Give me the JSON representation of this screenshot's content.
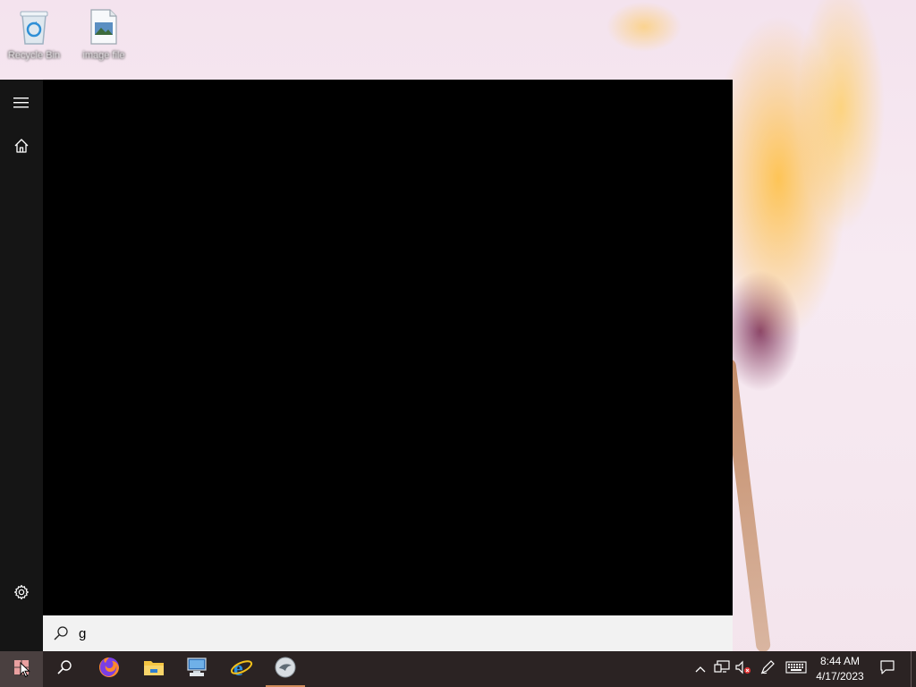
{
  "desktop": {
    "icons": [
      {
        "label": "Recycle Bin",
        "icon": "recycle-bin-icon"
      },
      {
        "label": "image file",
        "icon": "image-file-icon"
      }
    ]
  },
  "start_menu": {
    "rail": {
      "expand": {
        "icon": "hamburger-menu-icon"
      },
      "home": {
        "icon": "home-icon"
      },
      "settings": {
        "icon": "gear-icon"
      }
    },
    "search": {
      "value": "g",
      "icon": "search-icon"
    }
  },
  "taskbar": {
    "pinned": [
      {
        "name": "start",
        "icon": "windows-logo-icon"
      },
      {
        "name": "search",
        "icon": "search-icon"
      },
      {
        "name": "firefox",
        "icon": "firefox-icon"
      },
      {
        "name": "file-explorer",
        "icon": "folder-icon"
      },
      {
        "name": "network",
        "icon": "computer-network-icon"
      },
      {
        "name": "internet-explorer",
        "icon": "internet-explorer-icon"
      },
      {
        "name": "app",
        "icon": "app-icon",
        "active": true
      }
    ],
    "tray": {
      "icons": [
        "chevron-up-icon",
        "network-icon",
        "volume-muted-icon",
        "pen-icon",
        "keyboard-icon"
      ],
      "time": "8:44 AM",
      "date": "4/17/2023",
      "notifications": "action-center-icon"
    },
    "colors": {
      "background": "#2b2323",
      "active_indicator": "#d08a5a"
    }
  }
}
